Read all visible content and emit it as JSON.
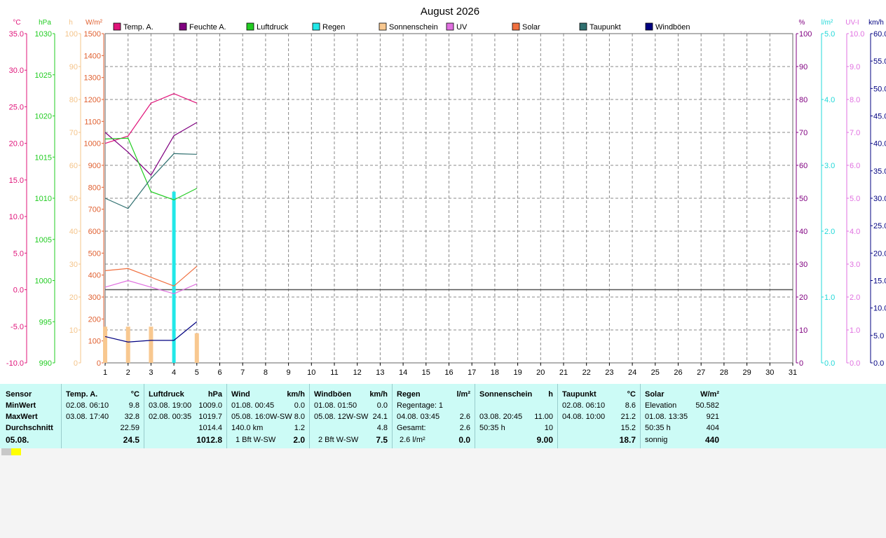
{
  "title": "August 2026",
  "left_axes": [
    {
      "unit": "°C",
      "color": "#e0147a",
      "ticks": [
        "35.0",
        "30.0",
        "25.0",
        "20.0",
        "15.0",
        "10.0",
        "5.0",
        "0.0",
        "-5.0",
        "-10.0"
      ]
    },
    {
      "unit": "hPa",
      "color": "#22cc22",
      "ticks": [
        "1030",
        "1025",
        "1020",
        "1015",
        "1010",
        "1005",
        "1000",
        "995",
        "990"
      ]
    },
    {
      "unit": "h",
      "color": "#f4c48a",
      "ticks": [
        "100",
        "90",
        "80",
        "70",
        "60",
        "50",
        "40",
        "30",
        "20",
        "10",
        "0"
      ]
    },
    {
      "unit": "W/m²",
      "color": "#e06030",
      "ticks": [
        "1500",
        "1400",
        "1300",
        "1200",
        "1100",
        "1000",
        "900",
        "800",
        "700",
        "600",
        "500",
        "400",
        "300",
        "200",
        "100",
        "0"
      ]
    }
  ],
  "right_axes": [
    {
      "unit": "%",
      "color": "#800080",
      "ticks": [
        "100",
        "90",
        "80",
        "70",
        "60",
        "50",
        "40",
        "30",
        "20",
        "10",
        "0"
      ]
    },
    {
      "unit": "l/m²",
      "color": "#22d8d8",
      "ticks": [
        "5.0",
        "4.0",
        "3.0",
        "2.0",
        "1.0",
        "0.0"
      ]
    },
    {
      "unit": "UV-I",
      "color": "#e070e0",
      "ticks": [
        "10.0",
        "9.0",
        "8.0",
        "7.0",
        "6.0",
        "5.0",
        "4.0",
        "3.0",
        "2.0",
        "1.0",
        "0.0"
      ]
    },
    {
      "unit": "km/h",
      "color": "#000080",
      "ticks": [
        "60.0",
        "55.0",
        "50.0",
        "45.0",
        "40.0",
        "35.0",
        "30.0",
        "25.0",
        "20.0",
        "15.0",
        "10.0",
        "5.0",
        "0.0"
      ]
    }
  ],
  "legend": [
    {
      "label": "Temp. A.",
      "color": "#e0147a"
    },
    {
      "label": "Feuchte A.",
      "color": "#800080"
    },
    {
      "label": "Luftdruck",
      "color": "#22cc22"
    },
    {
      "label": "Regen",
      "color": "#22e8e8"
    },
    {
      "label": "Sonnenschein",
      "color": "#f8c890"
    },
    {
      "label": "UV",
      "color": "#e070e0"
    },
    {
      "label": "Solar",
      "color": "#f07040"
    },
    {
      "label": "Taupunkt",
      "color": "#307070"
    },
    {
      "label": "Windböen",
      "color": "#000080"
    }
  ],
  "chart_data": {
    "type": "line",
    "title": "August 2026",
    "x": [
      "1",
      "2",
      "3",
      "4",
      "5",
      "6",
      "7",
      "8",
      "9",
      "10",
      "11",
      "12",
      "13",
      "14",
      "15",
      "16",
      "17",
      "18",
      "19",
      "20",
      "21",
      "22",
      "23",
      "24",
      "25",
      "26",
      "27",
      "28",
      "29",
      "30",
      "31"
    ],
    "grid": true,
    "ylims": {
      "temp_c": [
        -10,
        35
      ],
      "pressure_hpa": [
        990,
        1030
      ],
      "sunshine_h": [
        0,
        100
      ],
      "solar_wm2": [
        0,
        1500
      ],
      "humidity_pct": [
        0,
        100
      ],
      "rain_lm2": [
        0,
        5
      ],
      "uv_i": [
        0,
        10
      ],
      "wind_kmh": [
        0,
        60
      ]
    },
    "series": [
      {
        "name": "Temp. A.",
        "axis": "temp_c",
        "color": "#e0147a",
        "kind": "line",
        "x": [
          1,
          2,
          3,
          4,
          5
        ],
        "values": [
          20.0,
          21.0,
          25.5,
          26.8,
          25.5
        ]
      },
      {
        "name": "Feuchte A.",
        "axis": "humidity_pct",
        "color": "#800080",
        "kind": "line",
        "x": [
          1,
          2,
          3,
          4,
          5
        ],
        "values": [
          70,
          64,
          57,
          69,
          73
        ]
      },
      {
        "name": "Luftdruck",
        "axis": "pressure_hpa",
        "color": "#22cc22",
        "kind": "line",
        "x": [
          1,
          2,
          3,
          4,
          5
        ],
        "values": [
          1017.2,
          1017.3,
          1010.8,
          1009.8,
          1011.2
        ]
      },
      {
        "name": "Taupunkt",
        "axis": "temp_c",
        "color": "#307070",
        "kind": "line",
        "x": [
          1,
          2,
          3,
          4,
          5
        ],
        "values": [
          12.5,
          11.1,
          15.2,
          18.6,
          18.5
        ]
      },
      {
        "name": "Solar",
        "axis": "solar_wm2",
        "color": "#f07040",
        "kind": "line",
        "x": [
          1,
          2,
          3,
          4,
          5
        ],
        "values": [
          420,
          430,
          390,
          350,
          440
        ]
      },
      {
        "name": "UV",
        "axis": "uv_i",
        "color": "#e070e0",
        "kind": "line",
        "x": [
          1,
          2,
          3,
          4,
          5
        ],
        "values": [
          2.3,
          2.5,
          2.3,
          2.1,
          2.4
        ]
      },
      {
        "name": "Windböen",
        "axis": "wind_kmh",
        "color": "#000080",
        "kind": "line",
        "x": [
          1,
          2,
          3,
          4,
          5
        ],
        "values": [
          4.8,
          3.8,
          4.1,
          4.1,
          7.5
        ]
      },
      {
        "name": "Sonnenschein",
        "axis": "sunshine_h",
        "color": "#f8c890",
        "kind": "bar",
        "x": [
          1,
          2,
          3,
          5
        ],
        "values": [
          11,
          11,
          11,
          9
        ]
      },
      {
        "name": "Regen",
        "axis": "rain_lm2",
        "color": "#22e8e8",
        "kind": "bar",
        "x": [
          4
        ],
        "values": [
          2.6
        ]
      }
    ],
    "reference_line": {
      "axis": "temp_c",
      "value": 0
    }
  },
  "summary": {
    "sensor": {
      "title": "Sensor",
      "rows": [
        "MinWert",
        "MaxWert",
        "Durchschnitt",
        "05.08."
      ]
    },
    "temp": {
      "title": "Temp. A.",
      "unit": "°C",
      "min_date": "02.08.  06:10",
      "min": "9.8",
      "max_date": "03.08.  17:40",
      "max": "32.8",
      "avg": "22.59",
      "today": "24.5"
    },
    "pressure": {
      "title": "Luftdruck",
      "unit": "hPa",
      "min_date": "03.08.  19:00",
      "min": "1009.0",
      "max_date": "02.08.  00:35",
      "max": "1019.7",
      "avg": "1014.4",
      "today": "1012.8"
    },
    "wind": {
      "title": "Wind",
      "unit": "km/h",
      "min_date": "01.08.  00:45",
      "min": "0.0",
      "max_date": "05.08.  16:0W-SW",
      "max": "8.0",
      "avg_label": "140.0 km",
      "avg": "1.2",
      "today_label": "1 Bft W-SW",
      "today": "2.0"
    },
    "gusts": {
      "title": "Windböen",
      "unit": "km/h",
      "min_date": "01.08.  01:50",
      "min": "0.0",
      "max_date": "05.08.  12W-SW",
      "max": "24.1",
      "avg": "4.8",
      "today_label": "2 Bft W-SW",
      "today": "7.5"
    },
    "rain": {
      "title": "Regen",
      "unit": "l/m²",
      "row1": "Regentage: 1",
      "max_date": "04.08.  03:45",
      "max": "2.6",
      "total_label": "Gesamt:",
      "total": "2.6",
      "today_label": "2.6 l/m²",
      "today": "0.0"
    },
    "sunshine": {
      "title": "Sonnenschein",
      "unit": "h",
      "max_date": "03.08.  20:45",
      "max": "11.00",
      "avg_label": "50:35 h",
      "avg": "10",
      "today": "9.00"
    },
    "dewpoint": {
      "title": "Taupunkt",
      "unit": "°C",
      "min_date": "02.08.  06:10",
      "min": "8.6",
      "max_date": "04.08.  10:00",
      "max": "21.2",
      "avg": "15.2",
      "today": "18.7"
    },
    "solar": {
      "title": "Solar",
      "unit": "W/m²",
      "elev_label": "Elevation",
      "elev": "50.582",
      "max_date": "01.08.  13:35",
      "max": "921",
      "avg_label": "50:35 h",
      "avg": "404",
      "today_label": "sonnig",
      "today": "440"
    }
  }
}
